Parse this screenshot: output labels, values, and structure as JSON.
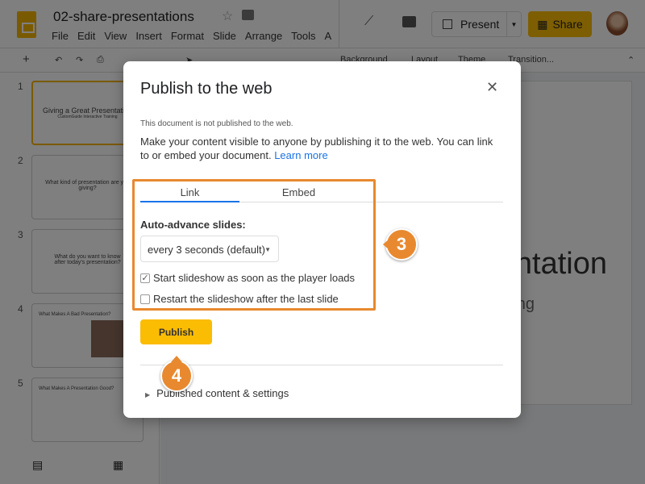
{
  "app": {
    "doc_title": "02-share-presentations",
    "menu": [
      "File",
      "Edit",
      "View",
      "Insert",
      "Format",
      "Slide",
      "Arrange",
      "Tools",
      "A"
    ],
    "present_label": "Present",
    "share_label": "Share"
  },
  "toolbar": {
    "background": "Background",
    "layout": "Layout",
    "theme": "Theme",
    "transition": "Transition..."
  },
  "filmstrip": [
    {
      "num": "1",
      "title": "Giving a Great Presentation",
      "subtitle": "CustomGuide Interactive Training"
    },
    {
      "num": "2",
      "title": "What kind of presentation are you giving?"
    },
    {
      "num": "3",
      "title": "What do you want to know after today's presentation?"
    },
    {
      "num": "4",
      "title": "What Makes A Bad Presentation?"
    },
    {
      "num": "5",
      "title": "What Makes A Presentation Good?"
    }
  ],
  "slide": {
    "title_fragment": "ntation",
    "subtitle_fragment": "ing"
  },
  "dialog": {
    "title": "Publish to the web",
    "status": "This document is not published to the web.",
    "description": "Make your content visible to anyone by publishing it to the web. You can link to or embed your document. ",
    "learn_more": "Learn more",
    "tabs": [
      "Link",
      "Embed"
    ],
    "auto_advance_label": "Auto-advance slides:",
    "auto_advance_value": "every 3 seconds (default)",
    "start_on_load": {
      "label": "Start slideshow as soon as the player loads",
      "checked": true
    },
    "restart": {
      "label": "Restart the slideshow after the last slide",
      "checked": false
    },
    "publish_label": "Publish",
    "published_settings": "Published content & settings"
  },
  "callouts": [
    "3",
    "4"
  ],
  "colors": {
    "accent": "#fbbc04",
    "callout": "#e8892f",
    "link": "#1a73e8"
  }
}
